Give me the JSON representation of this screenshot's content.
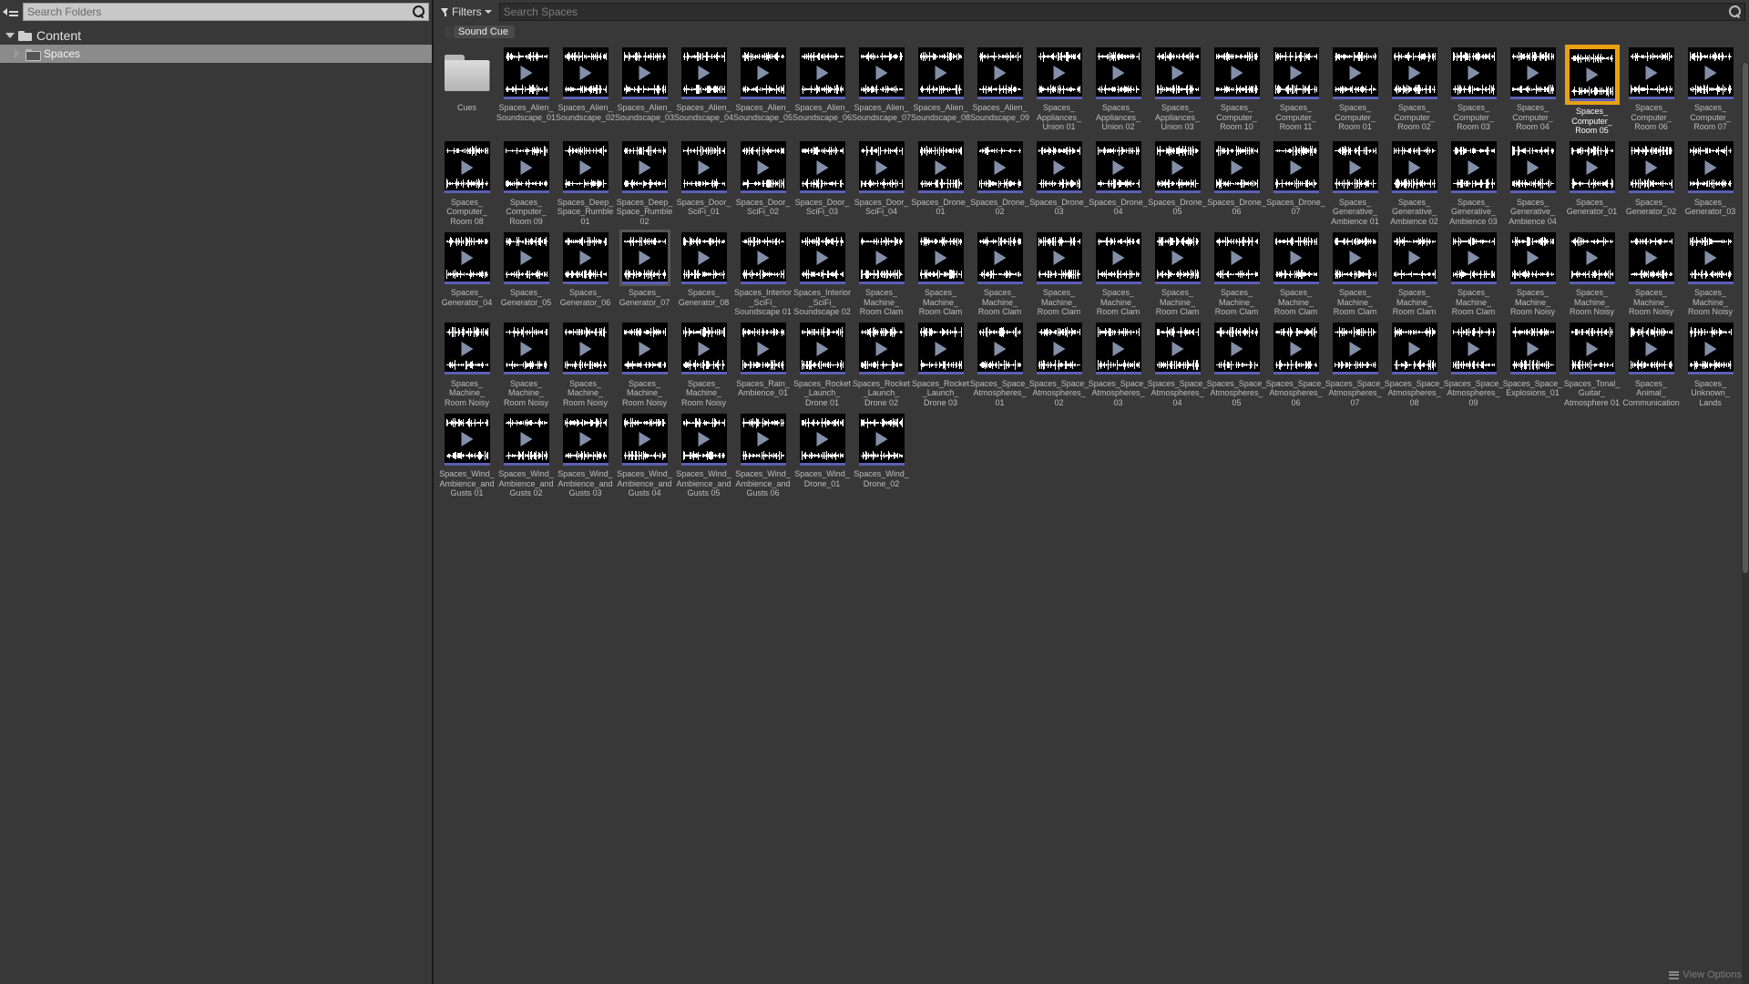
{
  "left_panel": {
    "search": {
      "placeholder": "Search Folders",
      "value": ""
    },
    "menu_icon": "hamburger-icon",
    "tree": [
      {
        "label": "Content",
        "level": 1,
        "expanded": true,
        "selected": false
      },
      {
        "label": "Spaces",
        "level": 2,
        "expanded": false,
        "selected": true
      }
    ]
  },
  "toolbar": {
    "filters_label": "Filters",
    "search": {
      "placeholder": "Search Spaces",
      "value": ""
    },
    "active_filters": [
      {
        "label": "Sound Cue",
        "color": "#4a4a4a"
      }
    ]
  },
  "colors": {
    "selection": "#e8a012",
    "asset_type_bar": "#5b5fb5",
    "panel_bg": "#383838",
    "thumb_bg": "#000000",
    "play_glyph": "#9aa8c6"
  },
  "status": {
    "path_text": "",
    "view_options_label": "View Options"
  },
  "assets": [
    {
      "name": "Cues",
      "type": "folder"
    },
    {
      "name": "Spaces_Alien_\nSoundscape_01",
      "type": "sound-cue"
    },
    {
      "name": "Spaces_Alien_\nSoundscape_02",
      "type": "sound-cue"
    },
    {
      "name": "Spaces_Alien_\nSoundscape_03",
      "type": "sound-cue"
    },
    {
      "name": "Spaces_Alien_\nSoundscape_04",
      "type": "sound-cue"
    },
    {
      "name": "Spaces_Alien_\nSoundscape_05",
      "type": "sound-cue"
    },
    {
      "name": "Spaces_Alien_\nSoundscape_06",
      "type": "sound-cue"
    },
    {
      "name": "Spaces_Alien_\nSoundscape_07",
      "type": "sound-cue"
    },
    {
      "name": "Spaces_Alien_\nSoundscape_08",
      "type": "sound-cue"
    },
    {
      "name": "Spaces_Alien_\nSoundscape_09",
      "type": "sound-cue"
    },
    {
      "name": "Spaces_\nAppliances_\nUnion 01",
      "type": "sound-cue"
    },
    {
      "name": "Spaces_\nAppliances_\nUnion 02",
      "type": "sound-cue"
    },
    {
      "name": "Spaces_\nAppliances_\nUnion 03",
      "type": "sound-cue"
    },
    {
      "name": "Spaces_\nComputer_\nRoom 10",
      "type": "sound-cue"
    },
    {
      "name": "Spaces_\nComputer_\nRoom 11",
      "type": "sound-cue"
    },
    {
      "name": "Spaces_\nComputer_\nRoom 01",
      "type": "sound-cue"
    },
    {
      "name": "Spaces_\nComputer_\nRoom 02",
      "type": "sound-cue"
    },
    {
      "name": "Spaces_\nComputer_\nRoom 03",
      "type": "sound-cue"
    },
    {
      "name": "Spaces_\nComputer_\nRoom 04",
      "type": "sound-cue"
    },
    {
      "name": "Spaces_\nComputer_\nRoom 05",
      "type": "sound-cue",
      "selected": true
    },
    {
      "name": "Spaces_\nComputer_\nRoom 06",
      "type": "sound-cue"
    },
    {
      "name": "Spaces_\nComputer_\nRoom 07",
      "type": "sound-cue"
    },
    {
      "name": "Spaces_\nComputer_\nRoom 08",
      "type": "sound-cue"
    },
    {
      "name": "Spaces_\nComputer_\nRoom 09",
      "type": "sound-cue"
    },
    {
      "name": "Spaces_Deep_\nSpace_Rumble\n01",
      "type": "sound-cue"
    },
    {
      "name": "Spaces_Deep_\nSpace_Rumble\n02",
      "type": "sound-cue"
    },
    {
      "name": "Spaces_Door_\nSciFi_01",
      "type": "sound-cue"
    },
    {
      "name": "Spaces_Door_\nSciFi_02",
      "type": "sound-cue"
    },
    {
      "name": "Spaces_Door_\nSciFi_03",
      "type": "sound-cue"
    },
    {
      "name": "Spaces_Door_\nSciFi_04",
      "type": "sound-cue"
    },
    {
      "name": "Spaces_Drone_\n01",
      "type": "sound-cue"
    },
    {
      "name": "Spaces_Drone_\n02",
      "type": "sound-cue"
    },
    {
      "name": "Spaces_Drone_\n03",
      "type": "sound-cue"
    },
    {
      "name": "Spaces_Drone_\n04",
      "type": "sound-cue"
    },
    {
      "name": "Spaces_Drone_\n05",
      "type": "sound-cue"
    },
    {
      "name": "Spaces_Drone_\n06",
      "type": "sound-cue"
    },
    {
      "name": "Spaces_Drone_\n07",
      "type": "sound-cue"
    },
    {
      "name": "Spaces_\nGenerative_\nAmbience 01",
      "type": "sound-cue"
    },
    {
      "name": "Spaces_\nGenerative_\nAmbience 02",
      "type": "sound-cue"
    },
    {
      "name": "Spaces_\nGenerative_\nAmbience 03",
      "type": "sound-cue"
    },
    {
      "name": "Spaces_\nGenerative_\nAmbience 04",
      "type": "sound-cue"
    },
    {
      "name": "Spaces_\nGenerator_01",
      "type": "sound-cue"
    },
    {
      "name": "Spaces_\nGenerator_02",
      "type": "sound-cue"
    },
    {
      "name": "Spaces_\nGenerator_03",
      "type": "sound-cue"
    },
    {
      "name": "Spaces_\nGenerator_04",
      "type": "sound-cue"
    },
    {
      "name": "Spaces_\nGenerator_05",
      "type": "sound-cue"
    },
    {
      "name": "Spaces_\nGenerator_06",
      "type": "sound-cue"
    },
    {
      "name": "Spaces_\nGenerator_07",
      "type": "sound-cue",
      "hovered": true
    },
    {
      "name": "Spaces_\nGenerator_08",
      "type": "sound-cue"
    },
    {
      "name": "Spaces_Interior\n_SciFi_\nSoundscape 01",
      "type": "sound-cue"
    },
    {
      "name": "Spaces_Interior\n_SciFi_\nSoundscape 02",
      "type": "sound-cue"
    },
    {
      "name": "Spaces_\nMachine_\nRoom Clam",
      "type": "sound-cue"
    },
    {
      "name": "Spaces_\nMachine_\nRoom Clam",
      "type": "sound-cue"
    },
    {
      "name": "Spaces_\nMachine_\nRoom Clam",
      "type": "sound-cue"
    },
    {
      "name": "Spaces_\nMachine_\nRoom Clam",
      "type": "sound-cue"
    },
    {
      "name": "Spaces_\nMachine_\nRoom Clam",
      "type": "sound-cue"
    },
    {
      "name": "Spaces_\nMachine_\nRoom Clam",
      "type": "sound-cue"
    },
    {
      "name": "Spaces_\nMachine_\nRoom Clam",
      "type": "sound-cue"
    },
    {
      "name": "Spaces_\nMachine_\nRoom Clam",
      "type": "sound-cue"
    },
    {
      "name": "Spaces_\nMachine_\nRoom Clam",
      "type": "sound-cue"
    },
    {
      "name": "Spaces_\nMachine_\nRoom Clam",
      "type": "sound-cue"
    },
    {
      "name": "Spaces_\nMachine_\nRoom Clam",
      "type": "sound-cue"
    },
    {
      "name": "Spaces_\nMachine_\nRoom Noisy",
      "type": "sound-cue"
    },
    {
      "name": "Spaces_\nMachine_\nRoom Noisy",
      "type": "sound-cue"
    },
    {
      "name": "Spaces_\nMachine_\nRoom Noisy",
      "type": "sound-cue"
    },
    {
      "name": "Spaces_\nMachine_\nRoom Noisy",
      "type": "sound-cue"
    },
    {
      "name": "Spaces_\nMachine_\nRoom Noisy",
      "type": "sound-cue"
    },
    {
      "name": "Spaces_\nMachine_\nRoom Noisy",
      "type": "sound-cue"
    },
    {
      "name": "Spaces_\nMachine_\nRoom Noisy",
      "type": "sound-cue"
    },
    {
      "name": "Spaces_\nMachine_\nRoom Noisy",
      "type": "sound-cue"
    },
    {
      "name": "Spaces_\nMachine_\nRoom Noisy",
      "type": "sound-cue"
    },
    {
      "name": "Spaces_Rain_\nAmbience_01",
      "type": "sound-cue"
    },
    {
      "name": "Spaces_Rocket\n_Launch_\nDrone 01",
      "type": "sound-cue"
    },
    {
      "name": "Spaces_Rocket\n_Launch_\nDrone 02",
      "type": "sound-cue"
    },
    {
      "name": "Spaces_Rocket\n_Launch_\nDrone 03",
      "type": "sound-cue"
    },
    {
      "name": "Spaces_Space_\nAtmospheres_\n01",
      "type": "sound-cue"
    },
    {
      "name": "Spaces_Space_\nAtmospheres_\n02",
      "type": "sound-cue"
    },
    {
      "name": "Spaces_Space_\nAtmospheres_\n03",
      "type": "sound-cue"
    },
    {
      "name": "Spaces_Space_\nAtmospheres_\n04",
      "type": "sound-cue"
    },
    {
      "name": "Spaces_Space_\nAtmospheres_\n05",
      "type": "sound-cue"
    },
    {
      "name": "Spaces_Space_\nAtmospheres_\n06",
      "type": "sound-cue"
    },
    {
      "name": "Spaces_Space_\nAtmospheres_\n07",
      "type": "sound-cue"
    },
    {
      "name": "Spaces_Space_\nAtmospheres_\n08",
      "type": "sound-cue"
    },
    {
      "name": "Spaces_Space_\nAtmospheres_\n09",
      "type": "sound-cue"
    },
    {
      "name": "Spaces_Space_\nExplosions_01",
      "type": "sound-cue"
    },
    {
      "name": "Spaces_Tonal_\nGuitar_\nAtmosphere 01",
      "type": "sound-cue"
    },
    {
      "name": "Spaces_\nAnimal_\nCommunication",
      "type": "sound-cue"
    },
    {
      "name": "Spaces_\nUnknown_\nLands",
      "type": "sound-cue"
    },
    {
      "name": "Spaces_Wind_\nAmbience_and\nGusts 01",
      "type": "sound-cue"
    },
    {
      "name": "Spaces_Wind_\nAmbience_and\nGusts 02",
      "type": "sound-cue"
    },
    {
      "name": "Spaces_Wind_\nAmbience_and\nGusts 03",
      "type": "sound-cue"
    },
    {
      "name": "Spaces_Wind_\nAmbience_and\nGusts 04",
      "type": "sound-cue"
    },
    {
      "name": "Spaces_Wind_\nAmbience_and\nGusts 05",
      "type": "sound-cue"
    },
    {
      "name": "Spaces_Wind_\nAmbience_and\nGusts 06",
      "type": "sound-cue"
    },
    {
      "name": "Spaces_Wind_\nDrone_01",
      "type": "sound-cue"
    },
    {
      "name": "Spaces_Wind_\nDrone_02",
      "type": "sound-cue"
    }
  ]
}
